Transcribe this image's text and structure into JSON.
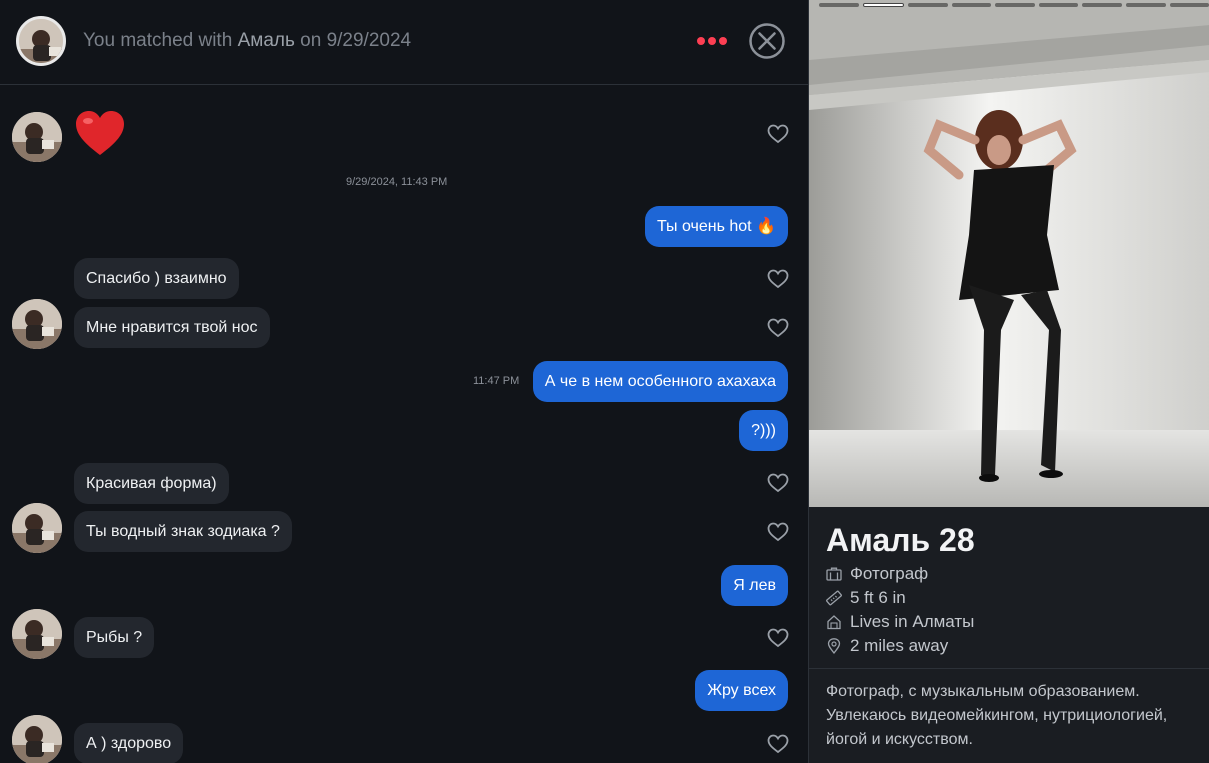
{
  "header": {
    "match_prefix": "You matched with",
    "match_name": "Амаль",
    "match_date_prefix": "on",
    "match_date": "9/29/2024"
  },
  "messages": {
    "heart_emoji": "❤️",
    "date_separator": "9/29/2024, 11:43 PM",
    "m1": "Ты очень hot 🔥",
    "m2": "Спасибо ) взаимно",
    "m3": "Мне нравится твой нос",
    "m4_time": "11:47 PM",
    "m4": "А че в нем особенного ахахаха",
    "m5": "?)))",
    "m6": "Красивая форма)",
    "m7": "Ты водный знак зодиака ?",
    "m8": "Я лев",
    "m9": "Рыбы ?",
    "m10": "Жру всех",
    "m11": "А ) здорово"
  },
  "profile": {
    "name_age": "Амаль 28",
    "job": "Фотограф",
    "height": "5 ft 6 in",
    "lives": "Lives in Алматы",
    "distance": "2 miles away",
    "bio": "Фотограф, с музыкальным образованием. Увлекаюсь видеомейкингом, нутрициологией, йогой и искусством.",
    "photo_count": 9,
    "active_photo": 2
  },
  "colors": {
    "accent_red": "#fd3f53",
    "outgoing_bubble": "#1e66d6",
    "incoming_bubble": "#23272e",
    "background": "#111419"
  },
  "icons": [
    "more-icon",
    "close-icon",
    "heart-outline-icon",
    "briefcase-icon",
    "ruler-icon",
    "home-icon",
    "location-pin-icon"
  ]
}
